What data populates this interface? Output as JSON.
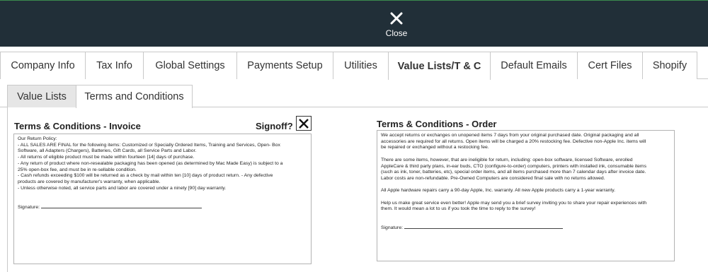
{
  "topbar": {
    "close_label": "Close",
    "close_icon": "x-icon"
  },
  "main_tabs": [
    {
      "label": "Company Info"
    },
    {
      "label": "Tax Info"
    },
    {
      "label": "Global Settings"
    },
    {
      "label": "Payments Setup"
    },
    {
      "label": "Utilities"
    },
    {
      "label": "Value Lists/T & C",
      "active": true
    },
    {
      "label": "Default Emails"
    },
    {
      "label": "Cert Files"
    },
    {
      "label": "Shopify"
    }
  ],
  "sub_tabs": [
    {
      "label": "Value Lists"
    },
    {
      "label": "Terms and Conditions",
      "active": true
    }
  ],
  "invoice": {
    "title": "Terms & Conditions - Invoice",
    "signoff_label": "Signoff?",
    "signoff_checked": true,
    "lines": [
      "Our Return Policy:",
      "- ALL SALES ARE FINAL for the following items: Customized or Specially Ordered Items, Training and Services, Open- Box",
      "Software, all Adapters (Chargers), Batteries, Gift Cards, all Service Parts and Labor.",
      "- All returns of eligible product must be made within fourteen [14] days of purchase.",
      "- Any return of product where non-resealable packaging has been opened (as determined by Mac Made Easy) is subject to a",
      "25% open-box fee, and must be in re-sellable condition.",
      "- Cash refunds exceeding $100 will be returned as a check by mail within ten [10] days of product return. - Any defective",
      "products are covered by manufacturer's warranty, when applicable.",
      "- Unless otherwise noted, all service parts and labor are covered under a ninety [90] day warranty."
    ],
    "signature_label": "Signature:"
  },
  "order": {
    "title": "Terms & Conditions - Order",
    "paragraphs": [
      [
        "We accept returns or exchanges on unopened items 7 days from your original purchased date. Original packaging and all",
        "accessories are required for all returns. Open items will be charged a 20% restocking fee. Defective non-Apple Inc. items will",
        "be repaired or exchanged without a restocking fee."
      ],
      [
        "There are some items, however, that are ineligible for return, including: open-box software, licensed Software, enrolled",
        "AppleCare & third party plans, in-ear buds, CTO (configure-to-order) computers, printers with installed ink, consumable items",
        "(such as ink, toner, batteries, etc), special order items, and all items purchased more than 7 calendar days after invoice date.",
        "Labor costs are non-refundable. Pre-Owned Computers are considered final sale with no returns allowed."
      ],
      [
        "All Apple hardware repairs carry a 90-day Apple, Inc. warranty. All new Apple products carry a 1-year warranty."
      ],
      [
        "Help us make great service even better! Apple may send you a brief survey inviting you to share your repair experiences with",
        "them. It would mean a lot to us if you took the time to reply to the survey!"
      ]
    ],
    "signature_label": "Signature:"
  }
}
